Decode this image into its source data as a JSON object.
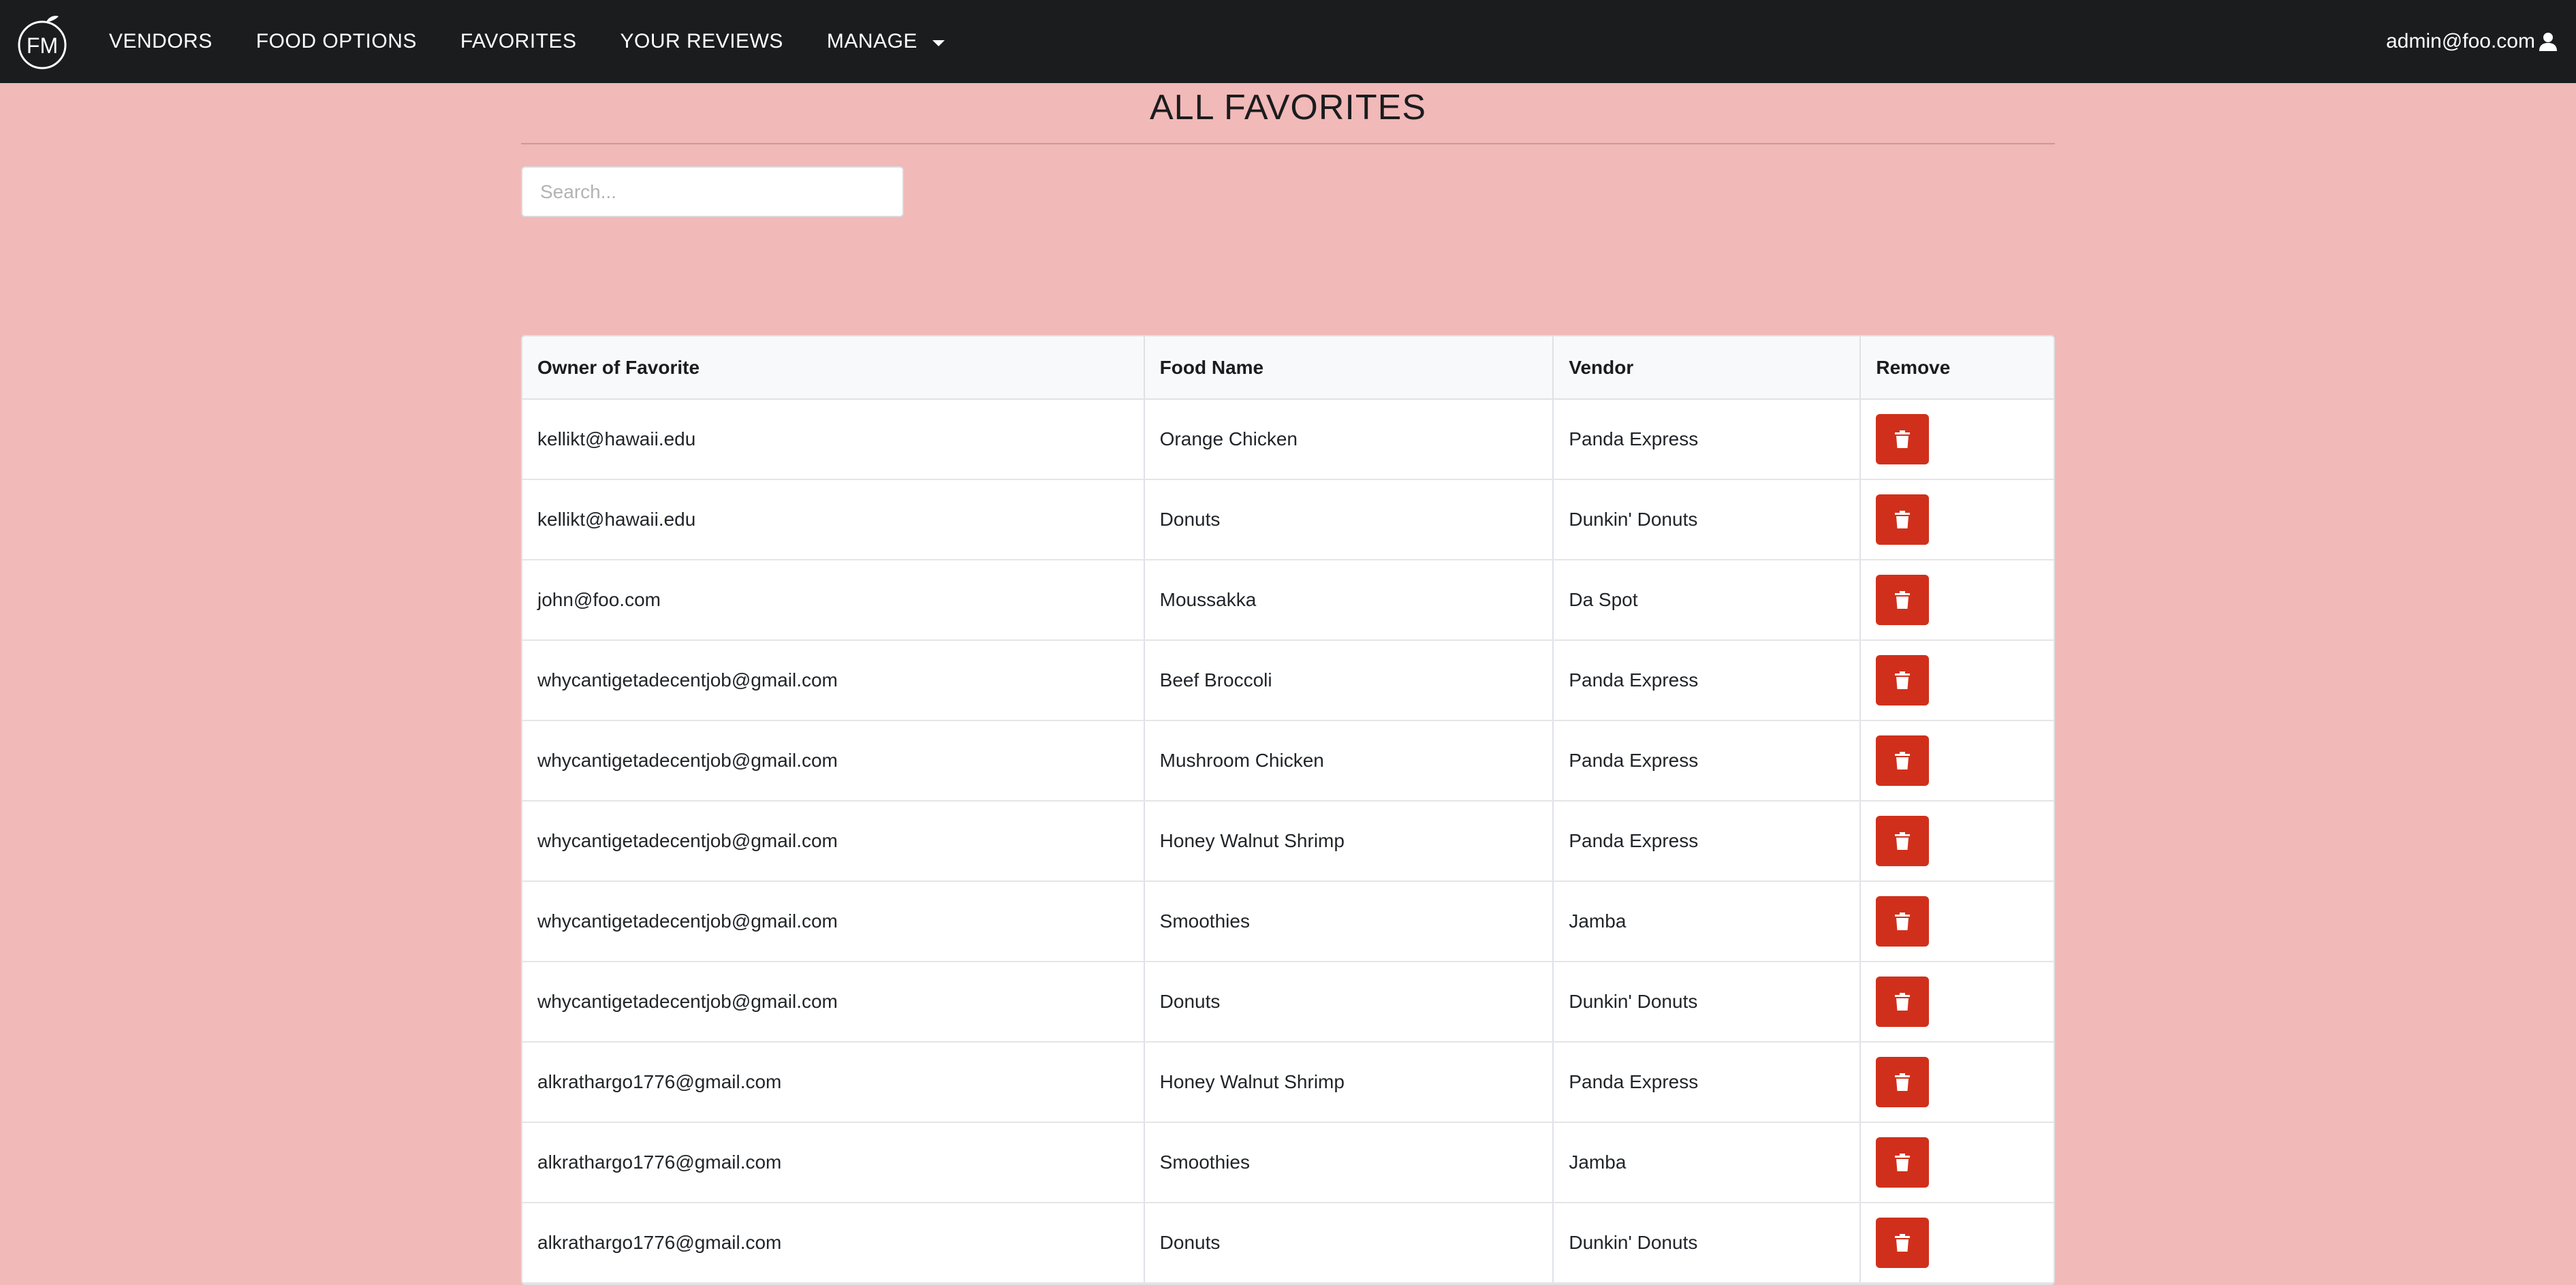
{
  "navbar": {
    "logo_text": "FM",
    "items": [
      {
        "label": "VENDORS"
      },
      {
        "label": "FOOD OPTIONS"
      },
      {
        "label": "FAVORITES"
      },
      {
        "label": "YOUR REVIEWS"
      },
      {
        "label": "MANAGE"
      }
    ],
    "user_email": "admin@foo.com"
  },
  "page": {
    "title": "ALL FAVORITES",
    "search_placeholder": "Search..."
  },
  "table": {
    "headers": [
      "Owner of Favorite",
      "Food Name",
      "Vendor",
      "Remove"
    ],
    "rows": [
      {
        "owner": "kellikt@hawaii.edu",
        "food": "Orange Chicken",
        "vendor": "Panda Express"
      },
      {
        "owner": "kellikt@hawaii.edu",
        "food": "Donuts",
        "vendor": "Dunkin' Donuts"
      },
      {
        "owner": "john@foo.com",
        "food": "Moussakka",
        "vendor": "Da Spot"
      },
      {
        "owner": "whycantigetadecentjob@gmail.com",
        "food": "Beef Broccoli",
        "vendor": "Panda Express"
      },
      {
        "owner": "whycantigetadecentjob@gmail.com",
        "food": "Mushroom Chicken",
        "vendor": "Panda Express"
      },
      {
        "owner": "whycantigetadecentjob@gmail.com",
        "food": "Honey Walnut Shrimp",
        "vendor": "Panda Express"
      },
      {
        "owner": "whycantigetadecentjob@gmail.com",
        "food": "Smoothies",
        "vendor": "Jamba"
      },
      {
        "owner": "whycantigetadecentjob@gmail.com",
        "food": "Donuts",
        "vendor": "Dunkin' Donuts"
      },
      {
        "owner": "alkrathargo1776@gmail.com",
        "food": "Honey Walnut Shrimp",
        "vendor": "Panda Express"
      },
      {
        "owner": "alkrathargo1776@gmail.com",
        "food": "Smoothies",
        "vendor": "Jamba"
      },
      {
        "owner": "alkrathargo1776@gmail.com",
        "food": "Donuts",
        "vendor": "Dunkin' Donuts"
      }
    ]
  },
  "colors": {
    "navbar_bg": "#1b1c1e",
    "page_bg": "#f1b9b8",
    "remove_button": "#d0301b"
  },
  "icons": {
    "remove": "trash-icon",
    "user": "user-icon",
    "manage_dropdown": "caret-down-icon"
  }
}
